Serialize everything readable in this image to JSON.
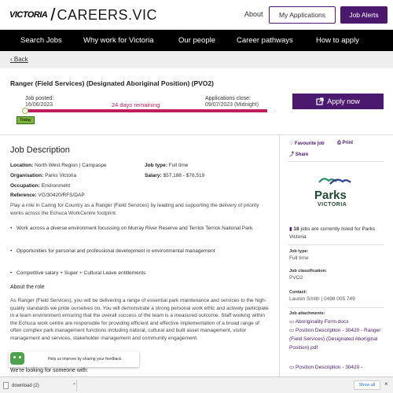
{
  "header": {
    "logo_mark": "VICTORIA",
    "logo_text": "CAREERS.VIC",
    "about": "About",
    "my_applications": "My Applications",
    "job_alerts": "Job Alerts"
  },
  "nav": [
    "Search Jobs",
    "Why work for Victoria",
    "Our people",
    "Career pathways",
    "How to apply"
  ],
  "back": "Back",
  "job": {
    "title": "Ranger (Field Services) (Designated Aboriginal Position) (PVO2)",
    "posted_label": "Job posted:",
    "posted_date": "16/06/2023",
    "remaining": "24 days remaining",
    "close_label": "Applications close:",
    "close_date": "09/07/2023 (Midnight)",
    "today": "Today",
    "apply": "Apply now"
  },
  "description": {
    "heading": "Job Description",
    "location_label": "Location:",
    "location": "North West Region | Campaspe",
    "org_label": "Organisation:",
    "org": "Parks Victoria",
    "occupation_label": "Occupation:",
    "occupation": "Environment",
    "reference_label": "Reference:",
    "reference": "VG/30420/RFS/DAP",
    "jobtype_label": "Job type:",
    "jobtype": "Full time",
    "salary_label": "Salary:",
    "salary": "$57,188 - $76,519",
    "intro": "Play a role in Caring for Country as a Ranger (Field Services) by leading and supporting the delivery of priority works across the Echuca WorkCentre footprint.",
    "bullets": [
      "Work across a diverse environment focussing on Murray River Reserve and Terrick Terrick National Park",
      "Opportunities for personal and professional development in environmental management",
      "Competitive salary + Super + Cultural Leave entitlements"
    ],
    "about_heading": "About the role",
    "about_text": "As Ranger (Field Services), you will be delivering a range of essential park maintenance and services to the high-quality standards we pride ourselves on. You will demonstrate a strong personal work ethic and actively participate in a team environment ensuring that the overall success of the team is a measured outcome. Staff working within the Echuca work centre are responsible for providing efficient and effective implementation of a broad range of often complex park management functions including natural, cultural and built asset management, visitor management and services, stakeholder management and community engagement.",
    "looking_heading": "We're looking for someone with:"
  },
  "sidebar": {
    "favourite": "Favourite job",
    "print": "Print",
    "share": "Share",
    "parks_word": "Parks",
    "victoria_word": "VICTORIA",
    "jobs_count": "18",
    "jobs_text": "jobs are currently listed for Parks Victoria",
    "jobtype_label": "Job type:",
    "jobtype": "Full time",
    "classification_label": "Job classification:",
    "classification": "PVO2",
    "contact_label": "Contact:",
    "contact": "Lauren Smith | 0498 005 749",
    "attachments_label": "Job attachments:",
    "attachments": [
      "Aboriginality Form.docx",
      "Position Description - 30420 - Ranger (Field Services) (Designated Aboriginal Position).pdf",
      "Position Description - 30420 -"
    ]
  },
  "feedback": "Help us improve by sharing your feedback.",
  "downloads": {
    "file": "download (2)",
    "show_all": "Show all"
  },
  "colors": {
    "brand_purple": "#4b1a6e",
    "countdown_pink": "#c01d5c",
    "today_green": "#7fb53a"
  }
}
